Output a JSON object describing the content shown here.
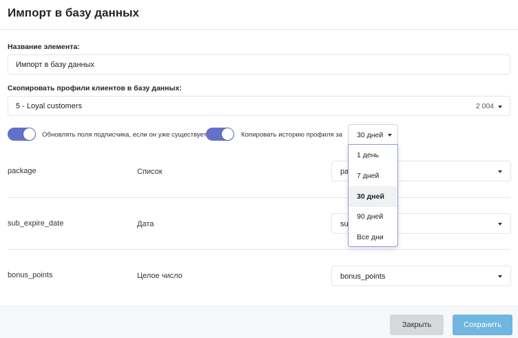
{
  "header": {
    "title": "Импорт в базу данных"
  },
  "name_field": {
    "label": "Название элемента:",
    "value": "Импорт в базу данных"
  },
  "profiles_field": {
    "label": "Скопировать профили клиентов в базу данных:",
    "value": "5 - Loyal customers",
    "count": "2 004"
  },
  "toggles": {
    "update_fields": {
      "label": "Обновлять поля подписчика, если он уже существует",
      "on": true
    },
    "copy_history": {
      "label": "Копировать историю профиля за",
      "on": true
    }
  },
  "period": {
    "selected": "30 дней",
    "options": [
      "1 день",
      "7 дней",
      "30 дней",
      "90 дней",
      "Все дни"
    ]
  },
  "mappings": [
    {
      "name": "package",
      "type": "Список",
      "select": "pa"
    },
    {
      "name": "sub_expire_date",
      "type": "Дата",
      "select": "su"
    },
    {
      "name": "bonus_points",
      "type": "Целое число",
      "select": "bonus_points"
    }
  ],
  "footer": {
    "close_label": "Закрыть",
    "save_label": "Сохранить"
  },
  "colors": {
    "accent": "#6470c9",
    "save_button": "#6fb6e0",
    "close_button": "#d6d8dc"
  }
}
